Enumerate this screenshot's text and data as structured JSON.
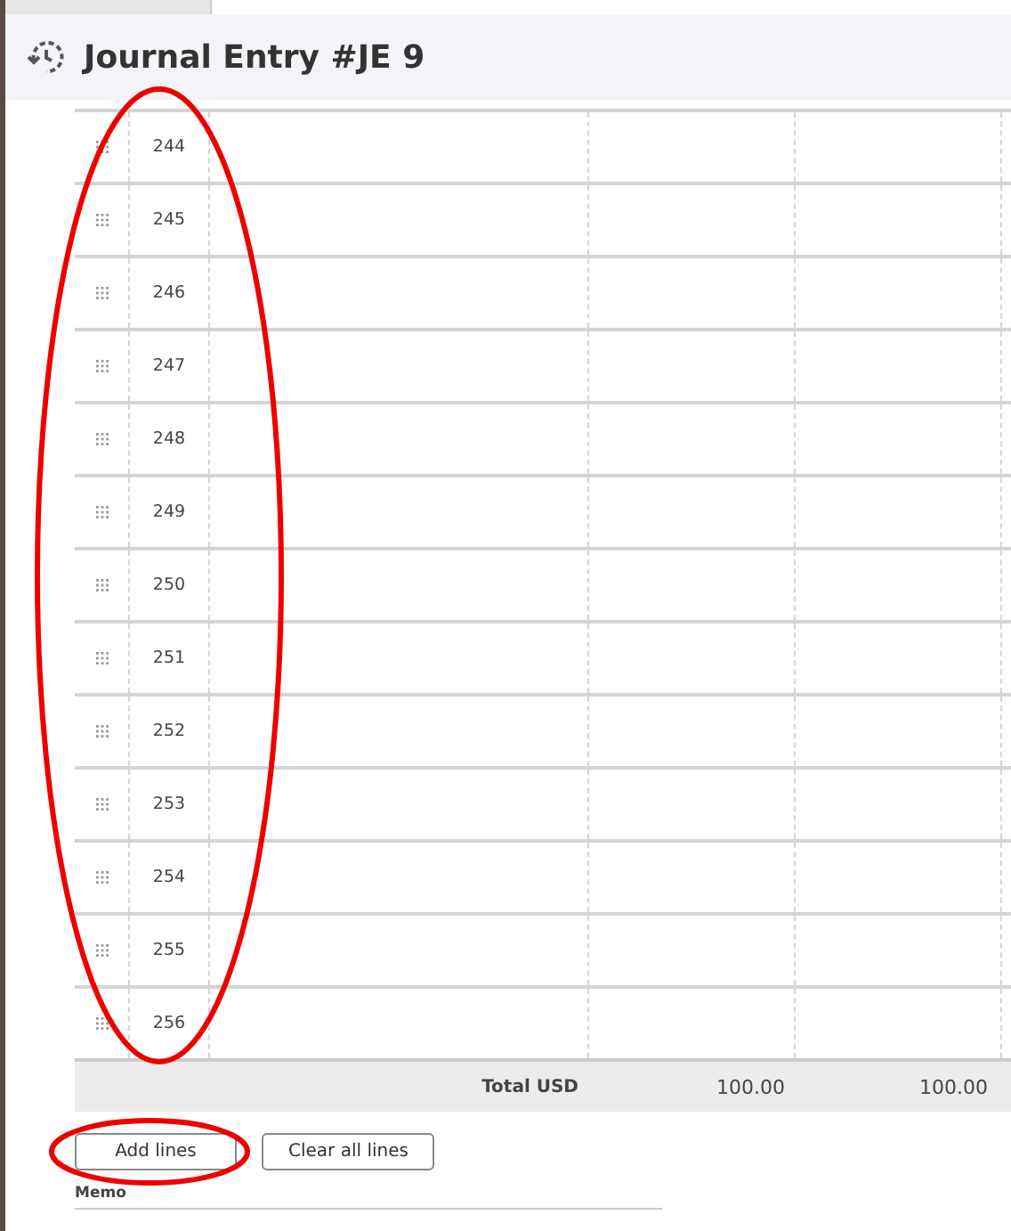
{
  "header": {
    "title": "Journal Entry #JE 9"
  },
  "table": {
    "rows": [
      {
        "line": "244"
      },
      {
        "line": "245"
      },
      {
        "line": "246"
      },
      {
        "line": "247"
      },
      {
        "line": "248"
      },
      {
        "line": "249"
      },
      {
        "line": "250"
      },
      {
        "line": "251"
      },
      {
        "line": "252"
      },
      {
        "line": "253"
      },
      {
        "line": "254"
      },
      {
        "line": "255"
      },
      {
        "line": "256"
      }
    ],
    "total": {
      "label": "Total USD",
      "debit": "100.00",
      "credit": "100.00"
    }
  },
  "buttons": [
    {
      "label": "Add lines"
    },
    {
      "label": "Clear all lines"
    }
  ],
  "memo": {
    "label": "Memo"
  }
}
